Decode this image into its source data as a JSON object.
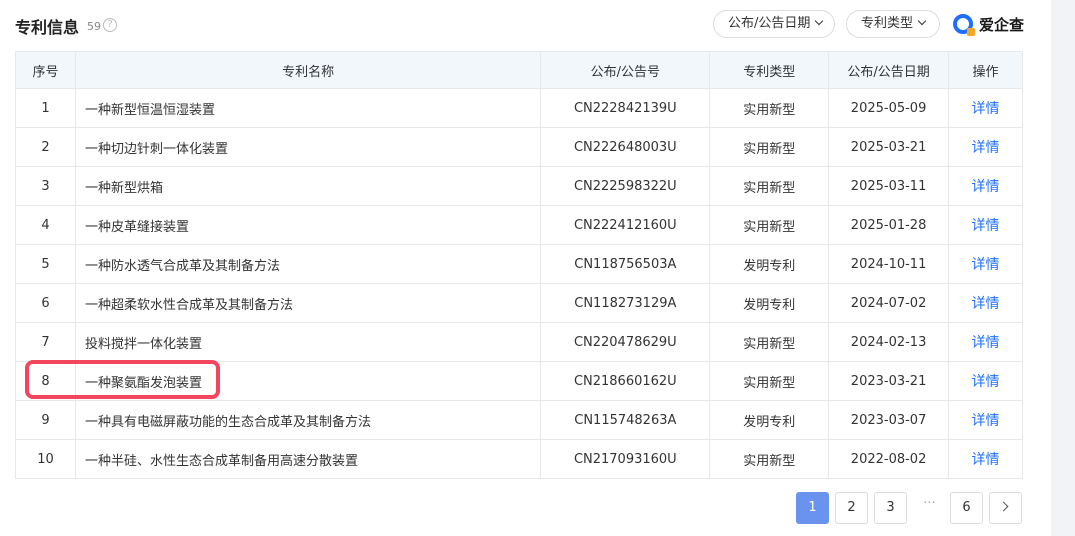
{
  "header": {
    "title": "专利信息",
    "count": "59",
    "help": "?",
    "dropdown_date": "公布/公告日期",
    "dropdown_type": "专利类型",
    "brand": "爱企查"
  },
  "table": {
    "columns": [
      "序号",
      "专利名称",
      "公布/公告号",
      "专利类型",
      "公布/公告日期",
      "操作"
    ],
    "rows": [
      {
        "idx": "1",
        "name": "一种新型恒温恒湿装置",
        "number": "CN222842139U",
        "type": "实用新型",
        "date": "2025-05-09",
        "op": "详情"
      },
      {
        "idx": "2",
        "name": "一种切边针刺一体化装置",
        "number": "CN222648003U",
        "type": "实用新型",
        "date": "2025-03-21",
        "op": "详情"
      },
      {
        "idx": "3",
        "name": "一种新型烘箱",
        "number": "CN222598322U",
        "type": "实用新型",
        "date": "2025-03-11",
        "op": "详情"
      },
      {
        "idx": "4",
        "name": "一种皮革缝接装置",
        "number": "CN222412160U",
        "type": "实用新型",
        "date": "2025-01-28",
        "op": "详情"
      },
      {
        "idx": "5",
        "name": "一种防水透气合成革及其制备方法",
        "number": "CN118756503A",
        "type": "发明专利",
        "date": "2024-10-11",
        "op": "详情"
      },
      {
        "idx": "6",
        "name": "一种超柔软水性合成革及其制备方法",
        "number": "CN118273129A",
        "type": "发明专利",
        "date": "2024-07-02",
        "op": "详情"
      },
      {
        "idx": "7",
        "name": "投料搅拌一体化装置",
        "number": "CN220478629U",
        "type": "实用新型",
        "date": "2024-02-13",
        "op": "详情"
      },
      {
        "idx": "8",
        "name": "一种聚氨酯发泡装置",
        "number": "CN218660162U",
        "type": "实用新型",
        "date": "2023-03-21",
        "op": "详情"
      },
      {
        "idx": "9",
        "name": "一种具有电磁屏蔽功能的生态合成革及其制备方法",
        "number": "CN115748263A",
        "type": "发明专利",
        "date": "2023-03-07",
        "op": "详情"
      },
      {
        "idx": "10",
        "name": "一种半硅、水性生态合成革制备用高速分散装置",
        "number": "CN217093160U",
        "type": "实用新型",
        "date": "2022-08-02",
        "op": "详情"
      }
    ]
  },
  "pagination": {
    "pages": [
      "1",
      "2",
      "3"
    ],
    "ellipsis": "···",
    "last": "6",
    "active": "1"
  },
  "colors": {
    "accent": "#1f6fff",
    "active_page": "#6a93ef",
    "highlight": "#f2455e",
    "header_bg": "#f2f7fc"
  }
}
